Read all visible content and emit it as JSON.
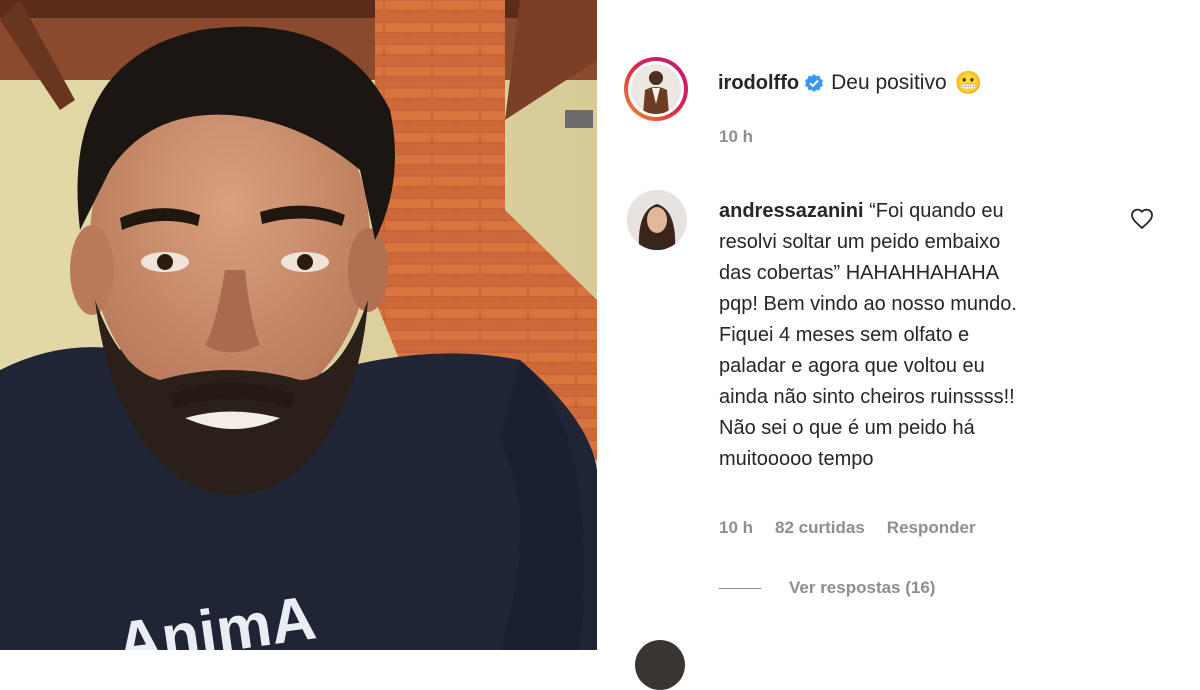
{
  "post": {
    "username": "irodolffo",
    "caption": "Deu positivo",
    "caption_emoji": "😬",
    "time": "10 h",
    "verified_icon": "verified-badge-icon"
  },
  "comment": {
    "username": "andressazanini",
    "text": "“Foi quando eu resolvi soltar um peido embaixo das cobertas” HAHAHHAHAHA pqp! Bem vindo ao nosso mundo. Fiquei 4 meses sem olfato e paladar e agora que voltou eu ainda não sinto cheiros ruinssss!! Não sei o que é um peido há muitooooo tempo",
    "lines": [
      "andressazanini “Foi quando eu",
      "resolvi soltar um peido embaixo",
      "das cobertas” HAHAHHAHAHA",
      "pqp! Bem vindo ao nosso mundo.",
      "Fiquei 4 meses sem olfato e",
      "paladar e agora que voltou eu",
      "ainda não sinto cheiros ruinssss!!",
      "Não sei o que é um peido há",
      "muitooooo tempo"
    ],
    "first_line_rest": "“Foi quando eu",
    "time": "10 h",
    "likes": "82 curtidas",
    "reply": "Responder",
    "view_replies": "Ver respostas (16)",
    "like_icon": "heart-icon"
  },
  "shirt_text": "AnimA",
  "colors": {
    "verified": "#3897f0",
    "text": "#262626",
    "muted": "#8e8e8e"
  }
}
